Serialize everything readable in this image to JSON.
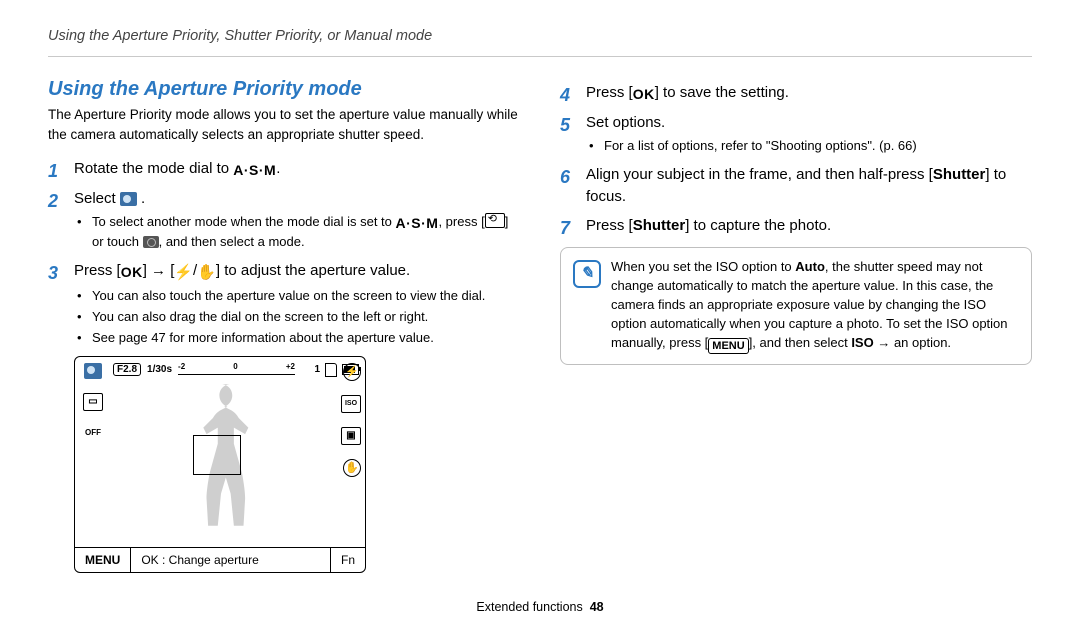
{
  "running_header": "Using the Aperture Priority, Shutter Priority, or Manual mode",
  "section_title": "Using the Aperture Priority mode",
  "intro": "The Aperture Priority mode allows you to set the aperture value manually while the camera automatically selects an appropriate shutter speed.",
  "steps": {
    "s1_a": "Rotate the mode dial to ",
    "s1_b": ".",
    "s2_a": "Select ",
    "s2_b": ".",
    "s2_sub_a": "To select another mode when the mode dial is set to ",
    "s2_sub_b": ", press [",
    "s2_sub_c": "] or touch ",
    "s2_sub_d": ", and then select a mode.",
    "s3_a": "Press [",
    "s3_b": "] → [",
    "s3_c": "/",
    "s3_d": "] to adjust the aperture value.",
    "s3_sub_1": "You can also touch the aperture value on the screen to view the dial.",
    "s3_sub_2": "You can also drag the dial on the screen to the left or right.",
    "s3_sub_3": "See page 47 for more information about the aperture value.",
    "s4_a": "Press [",
    "s4_b": "] to save the setting.",
    "s5": "Set options.",
    "s5_sub_1": "For a list of options, refer to \"Shooting options\". (p. 66)",
    "s6_a": "Align your subject in the frame, and then half-press [",
    "s6_b": "Shutter",
    "s6_c": "] to focus.",
    "s7_a": "Press [",
    "s7_b": "Shutter",
    "s7_c": "] to capture the photo."
  },
  "lcd": {
    "aperture": "F2.8",
    "shutter": "1/30s",
    "ev_minus": "-2",
    "ev_zero": "0",
    "ev_plus": "+2",
    "count": "1",
    "menu": "MENU",
    "ok_label": "OK : Change aperture",
    "fn": "Fn"
  },
  "note_a": "When you set the ISO option to ",
  "note_auto": "Auto",
  "note_b": ", the shutter speed may not change automatically to match the aperture value. In this case, the camera finds an appropriate exposure value by changing the ISO option automatically when you capture a photo. To set the ISO option manually, press [",
  "note_menu": "MENU",
  "note_c": "], and then select ",
  "note_iso": "ISO",
  "note_d": " → an option.",
  "footer_section": "Extended functions",
  "footer_page": "48",
  "icons": {
    "ok": "OK",
    "asm": "A·S·M"
  }
}
